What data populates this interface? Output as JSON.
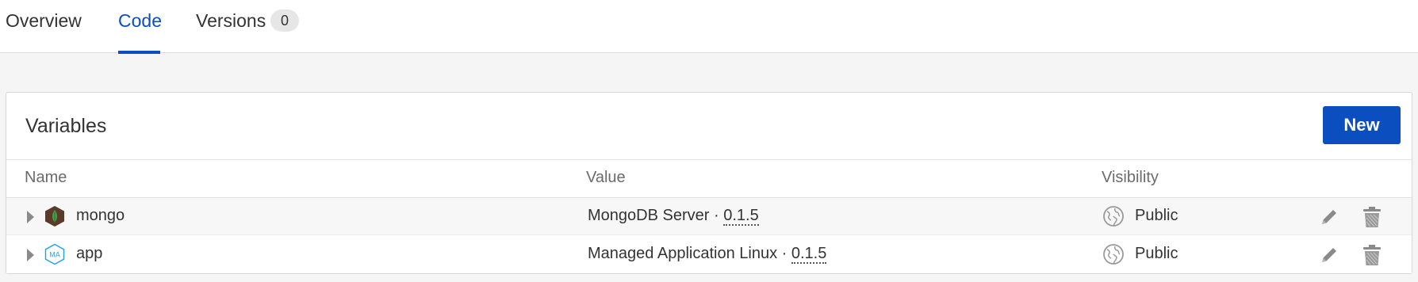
{
  "tabs": {
    "overview": "Overview",
    "code": "Code",
    "versions": "Versions",
    "versions_count": "0",
    "active": "Code"
  },
  "panel": {
    "title": "Variables",
    "new_button": "New"
  },
  "table": {
    "headers": {
      "name": "Name",
      "value": "Value",
      "visibility": "Visibility"
    },
    "rows": [
      {
        "name": "mongo",
        "icon": "mongodb-leaf-icon",
        "value_label": "MongoDB Server",
        "separator": "·",
        "version": "0.1.5",
        "visibility": "Public"
      },
      {
        "name": "app",
        "icon": "ma-hexagon-icon",
        "icon_text": "MA",
        "value_label": "Managed Application Linux",
        "separator": "·",
        "version": "0.1.5",
        "visibility": "Public"
      }
    ]
  },
  "colors": {
    "accent": "#0b4ec0",
    "mongo_icon_bg": "#5b3a29",
    "mongo_leaf": "#47a248",
    "ma_icon_stroke": "#2aa4e0"
  }
}
